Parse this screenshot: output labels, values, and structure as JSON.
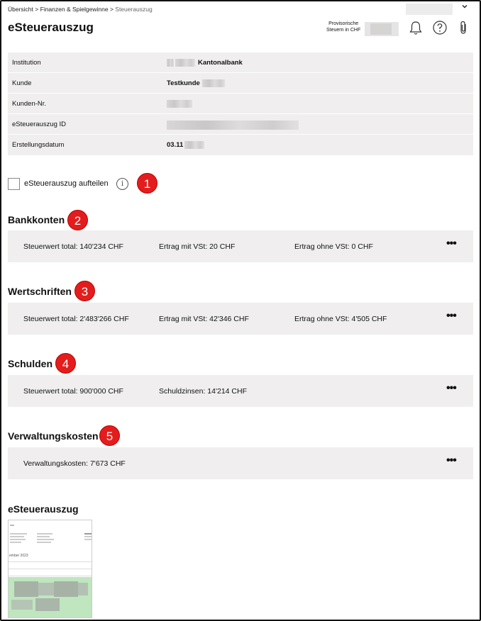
{
  "breadcrumb": {
    "item1": "Übersicht",
    "sep": ">",
    "item2": "Finanzen & Spielgewinne",
    "current": "Steuerauszug"
  },
  "header": {
    "title": "eSteuerauszug",
    "prov_line1": "Provisorische",
    "prov_line2": "Steuern in CHF"
  },
  "info": {
    "rows": [
      {
        "label": "Institution",
        "value": "Kantonalbank"
      },
      {
        "label": "Kunde",
        "value": "Testkunde"
      },
      {
        "label": "Kunden-Nr.",
        "value": ""
      },
      {
        "label": "eSteuerauszug ID",
        "value": ""
      },
      {
        "label": "Erstellungsdatum",
        "value": "03.11"
      }
    ]
  },
  "split": {
    "label": "eSteuerauszug aufteilen",
    "info_glyph": "i"
  },
  "badges": [
    "1",
    "2",
    "3",
    "4",
    "5"
  ],
  "sections": {
    "bankkonten": {
      "title": "Bankkonten",
      "c1": "Steuerwert total: 140'234 CHF",
      "c2": "Ertrag mit VSt: 20 CHF",
      "c3": "Ertrag ohne VSt: 0 CHF"
    },
    "wertschriften": {
      "title": "Wertschriften",
      "c1": "Steuerwert total: 2'483'266 CHF",
      "c2": "Ertrag mit VSt: 42'346 CHF",
      "c3": "Ertrag ohne VSt: 4'505 CHF"
    },
    "schulden": {
      "title": "Schulden",
      "c1": "Steuerwert total: 900'000 CHF",
      "c2": "Schuldzinsen: 14'214 CHF"
    },
    "verwaltungskosten": {
      "title": "Verwaltungskosten",
      "c1": "Verwaltungskosten: 7'673 CHF"
    }
  },
  "more_glyph": "•••",
  "document": {
    "title": "eSteuerauszug",
    "thumb_text": "ember 2023"
  },
  "icons": {
    "chevron": "chevron-down-icon",
    "bell": "bell-icon",
    "help": "help-icon",
    "attach": "paperclip-icon"
  },
  "colors": {
    "badge": "#e31d1d",
    "panel": "#f0eeee"
  }
}
